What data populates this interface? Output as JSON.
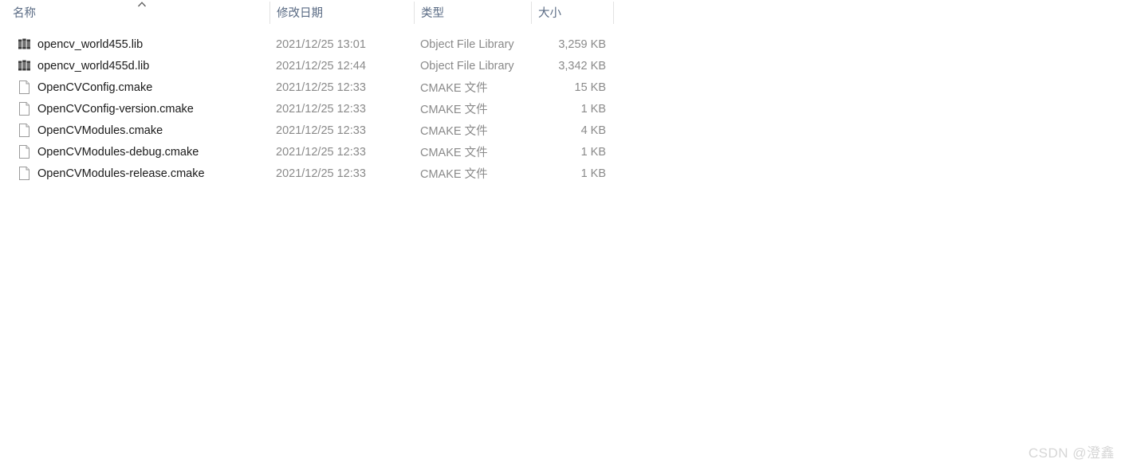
{
  "columns": {
    "name": "名称",
    "date_modified": "修改日期",
    "type": "类型",
    "size": "大小",
    "sort_indicator_icon": "chevron-up-icon",
    "sort_column": "名称",
    "sort_direction": "ascending"
  },
  "files": [
    {
      "icon": "library-file-icon",
      "name": "opencv_world455.lib",
      "date": "2021/12/25 13:01",
      "type": "Object File Library",
      "size": "3,259 KB"
    },
    {
      "icon": "library-file-icon",
      "name": "opencv_world455d.lib",
      "date": "2021/12/25 12:44",
      "type": "Object File Library",
      "size": "3,342 KB"
    },
    {
      "icon": "blank-document-icon",
      "name": "OpenCVConfig.cmake",
      "date": "2021/12/25 12:33",
      "type": "CMAKE 文件",
      "size": "15 KB"
    },
    {
      "icon": "blank-document-icon",
      "name": "OpenCVConfig-version.cmake",
      "date": "2021/12/25 12:33",
      "type": "CMAKE 文件",
      "size": "1 KB"
    },
    {
      "icon": "blank-document-icon",
      "name": "OpenCVModules.cmake",
      "date": "2021/12/25 12:33",
      "type": "CMAKE 文件",
      "size": "4 KB"
    },
    {
      "icon": "blank-document-icon",
      "name": "OpenCVModules-debug.cmake",
      "date": "2021/12/25 12:33",
      "type": "CMAKE 文件",
      "size": "1 KB"
    },
    {
      "icon": "blank-document-icon",
      "name": "OpenCVModules-release.cmake",
      "date": "2021/12/25 12:33",
      "type": "CMAKE 文件",
      "size": "1 KB"
    }
  ],
  "watermark": {
    "text": "CSDN @澄鑫"
  },
  "colors": {
    "header_text": "#5a6b84",
    "file_name_text": "#1a1a1a",
    "meta_text": "#8a8a8a",
    "divider": "#e2e2e2",
    "background": "#ffffff",
    "watermark": "#d6d6d6"
  }
}
